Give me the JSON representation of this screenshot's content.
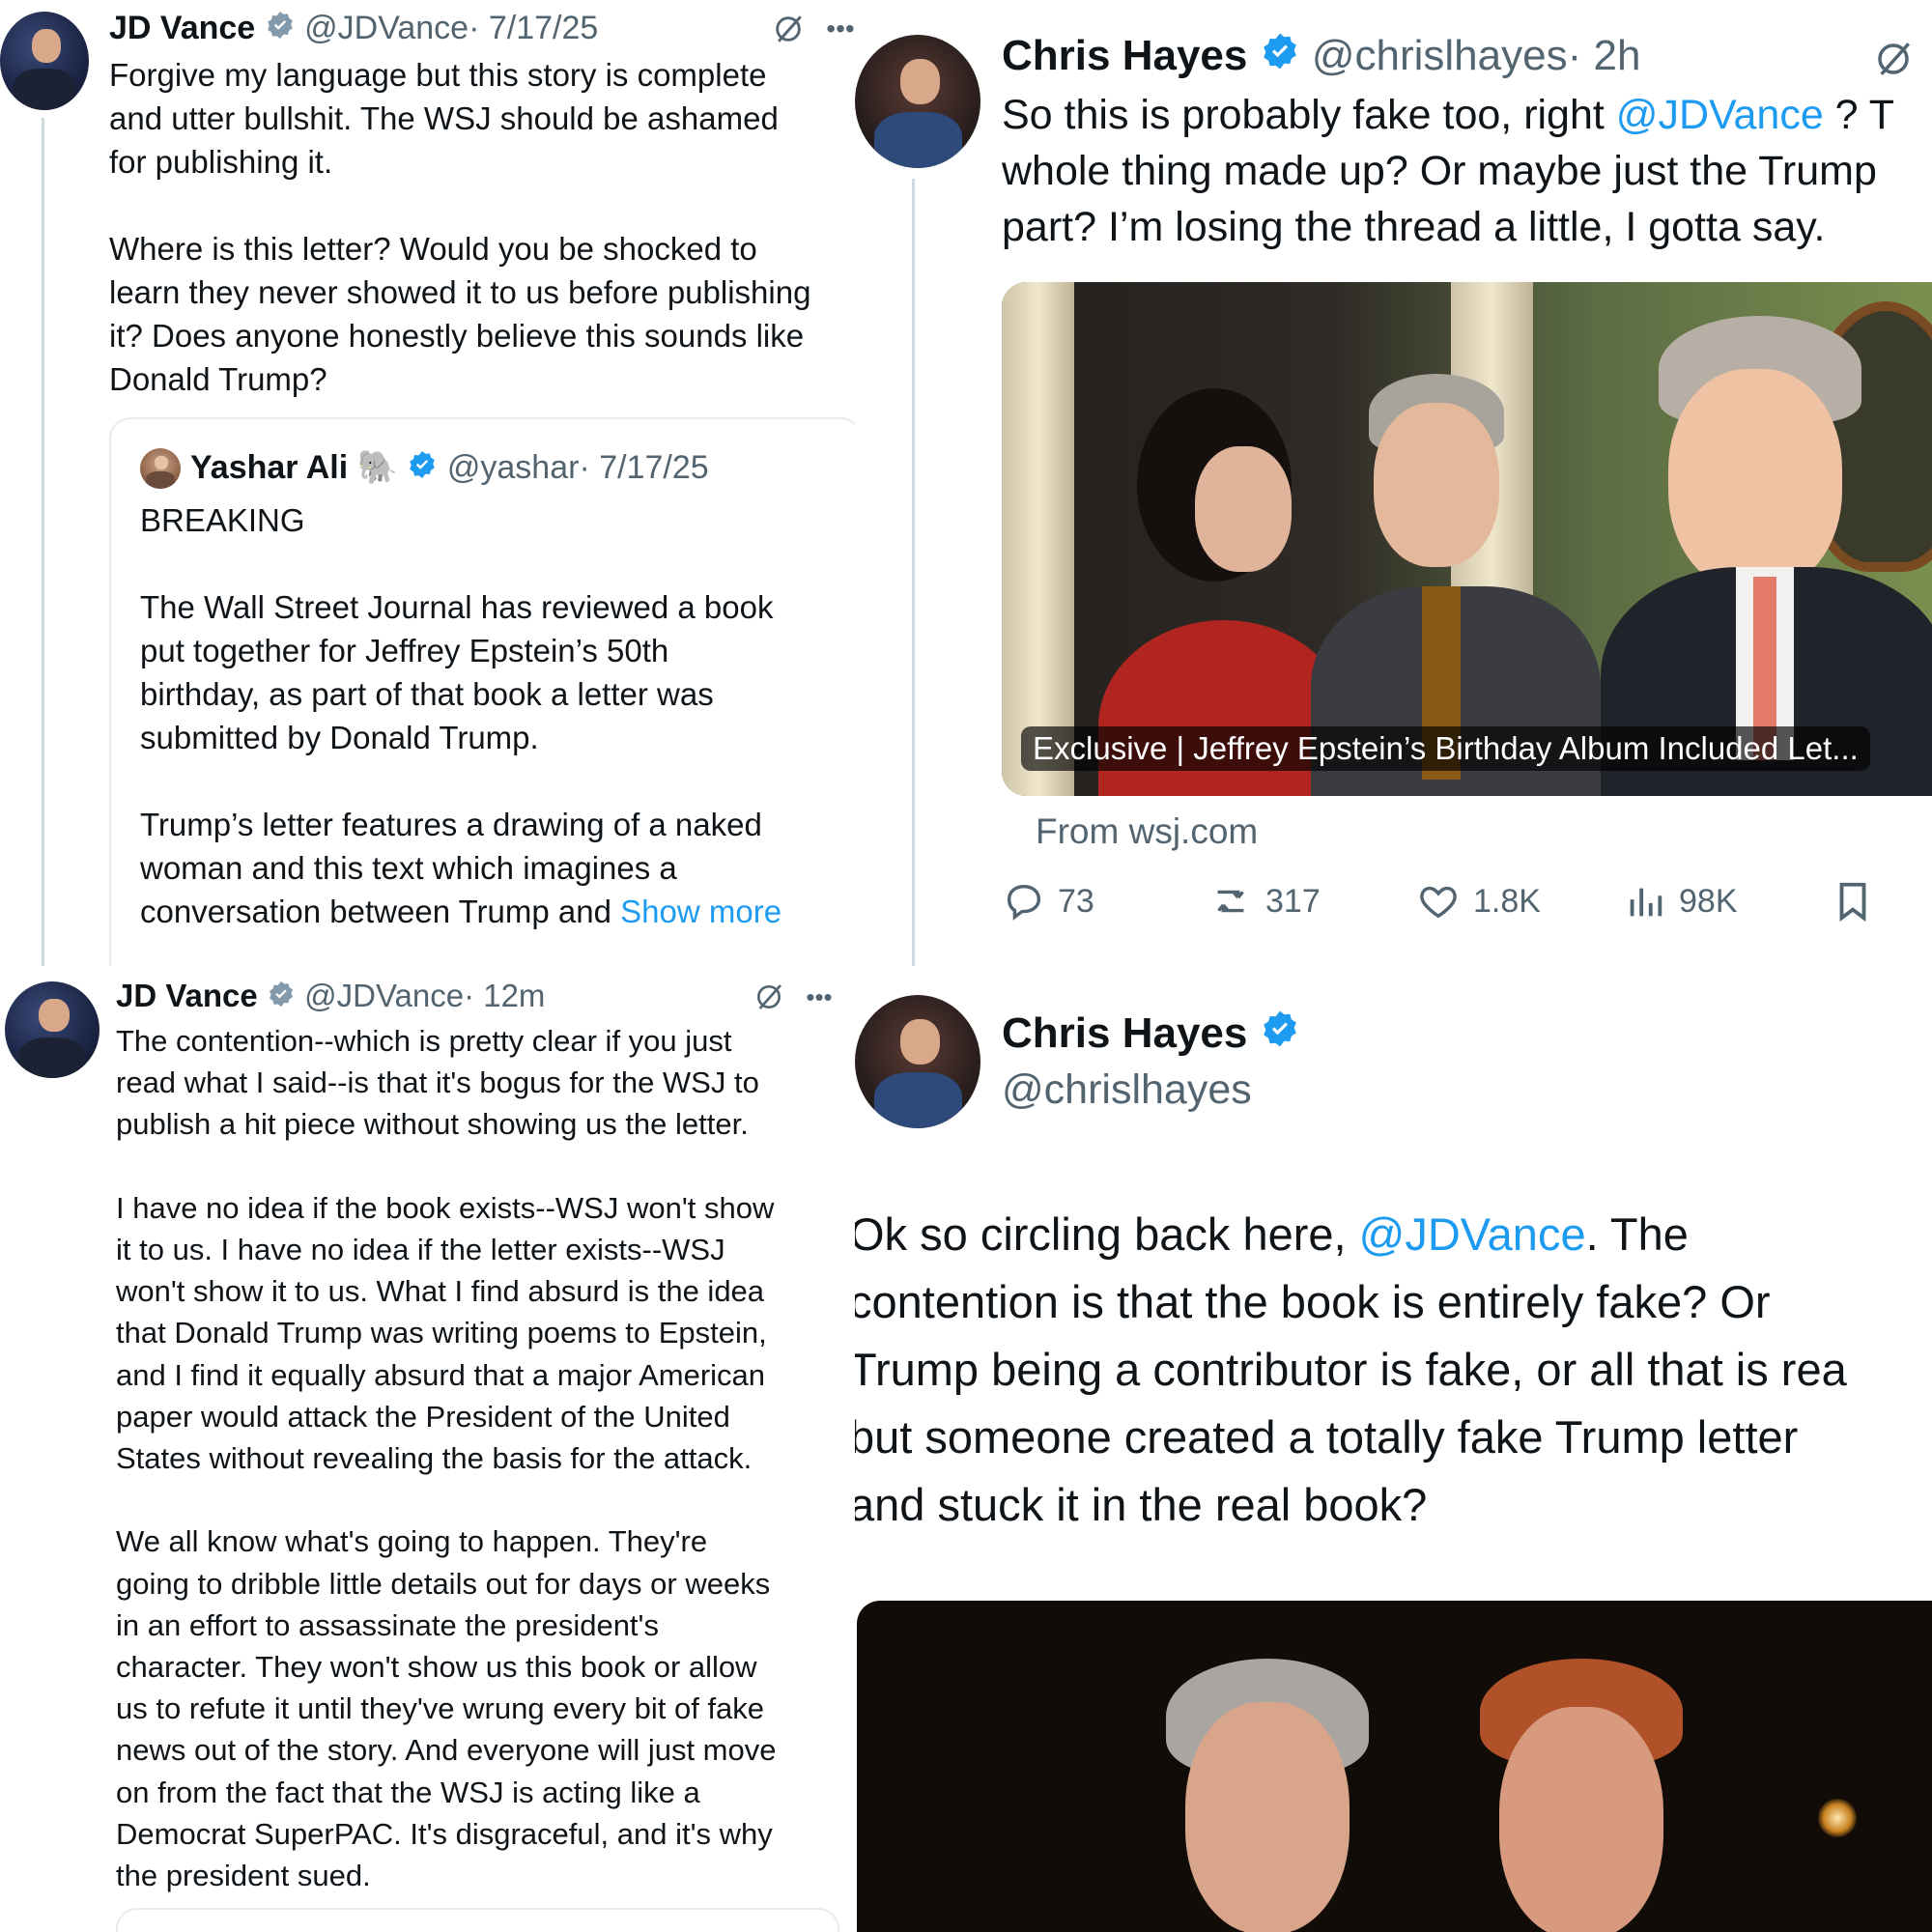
{
  "colors": {
    "link": "#1d9bf0",
    "verified": "#1d9bf0",
    "gray": "#536471"
  },
  "tweet1": {
    "name": "JD Vance",
    "handle": "@JDVance",
    "time": "· 7/17/25",
    "body": "Forgive my language but this story is complete\nand utter bullshit. The WSJ should be ashamed\nfor publishing it.\n\nWhere is this letter? Would you be shocked to\nlearn they never showed it to us before publishing\nit? Does anyone honestly believe this sounds like\nDonald Trump?",
    "quote": {
      "name": "Yashar Ali",
      "emoji": "🐘",
      "handle": "@yashar",
      "time": "· 7/17/25",
      "body": "BREAKING\n\nThe Wall Street Journal has reviewed a book\nput together for Jeffrey Epstein’s 50th\nbirthday, as part of that book a letter was\nsubmitted by Donald Trump.\n\nTrump’s letter features a drawing of a naked\nwoman and this text which imagines a\nconversation between Trump and ",
      "show_more": "Show more"
    }
  },
  "tweet2": {
    "name": "Chris Hayes",
    "handle": "@chrislhayes",
    "time": "· 2h",
    "body_pre": "So this is probably fake too, right ",
    "mention": "@JDVance",
    "body_post": " ? T\nwhole thing made up? Or maybe just the Trump\npart? I’m losing the thread a little, I gotta say.",
    "card_headline": "Exclusive | Jeffrey Epstein’s Birthday Album Included Let...",
    "card_source": "From wsj.com",
    "stats": {
      "replies": "73",
      "reposts": "317",
      "likes": "1.8K",
      "views": "98K"
    }
  },
  "tweet3": {
    "name": "JD Vance",
    "handle": "@JDVance",
    "time": "· 12m",
    "body": "The contention--which is pretty clear if you just\nread what I said--is that it's bogus for the WSJ to\npublish a hit piece without showing us the letter.\n\nI have no idea if the book exists--WSJ won't show\nit to us. I have no idea if the letter exists--WSJ\nwon't show it to us. What I find absurd is the idea\nthat Donald Trump was writing poems to Epstein,\nand I find it equally absurd that a major American\npaper would attack the President of the United\nStates without revealing the basis for the attack.\n\nWe all know what's going to happen. They're\ngoing to dribble little details out for days or weeks\nin an effort to assassinate the president's\ncharacter. They won't show us this book or allow\nus to refute it until they've wrung every bit of fake\nnews out of the story. And everyone will just move\non from the fact that the WSJ is acting like a\nDemocrat SuperPAC. It's disgraceful, and it's why\nthe president sued."
  },
  "tweet4": {
    "name": "Chris Hayes",
    "handle": "@chrislhayes",
    "body_pre": "Ok so circling back here, ",
    "mention": "@JDVance",
    "body_post": ". The\ncontention is that the book is entirely fake? Or\nTrump being a contributor is fake, or all that is rea\nbut someone created a totally fake Trump letter\nand stuck it in the real book?"
  }
}
